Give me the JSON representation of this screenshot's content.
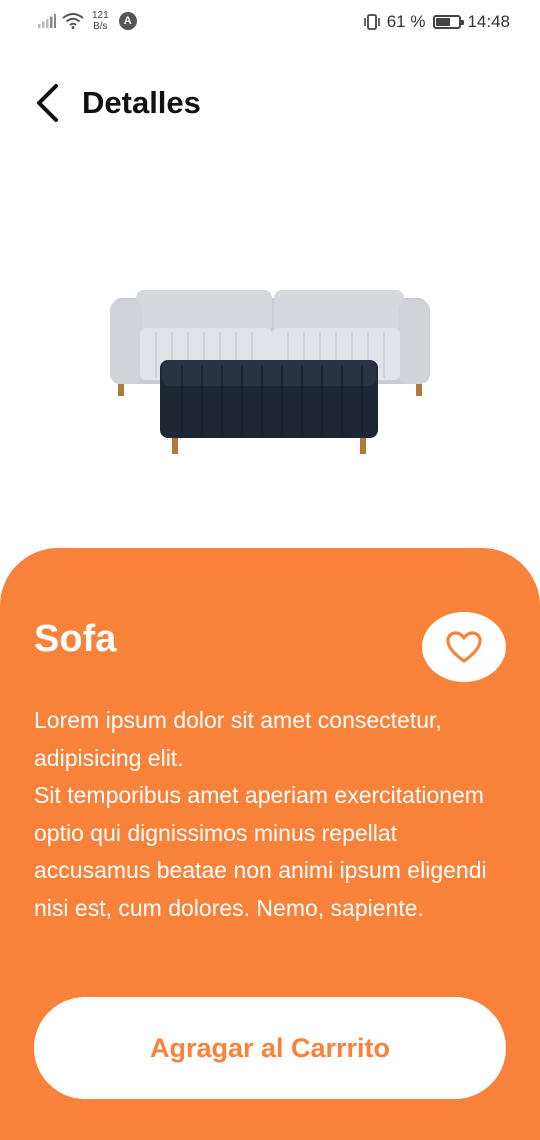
{
  "status_bar": {
    "net_speed_value": "121",
    "net_speed_unit": "B/s",
    "app_badge": "A",
    "battery_percent_text": "61 %",
    "battery_level": 0.61,
    "time": "14:48",
    "icons": [
      "signal-icon",
      "wifi-icon",
      "vibrate-icon",
      "battery-icon"
    ]
  },
  "header": {
    "title": "Detalles",
    "back_icon": "chevron-left-icon"
  },
  "product": {
    "name": "Sofa",
    "description": "Lorem ipsum dolor sit amet consectetur, adipisicing elit.\nSit temporibus amet aperiam exercitationem optio qui dignissimos minus repellat accusamus beatae non animi ipsum eligendi nisi est, cum dolores. Nemo, sapiente.",
    "favorite_icon": "heart-outline-icon",
    "image_icon": "sofa-image"
  },
  "actions": {
    "add_to_cart_label": "Agragar al Carrrito"
  },
  "colors": {
    "accent": "#f8823a",
    "card_text": "#ffffff",
    "button_bg": "#ffffff"
  }
}
